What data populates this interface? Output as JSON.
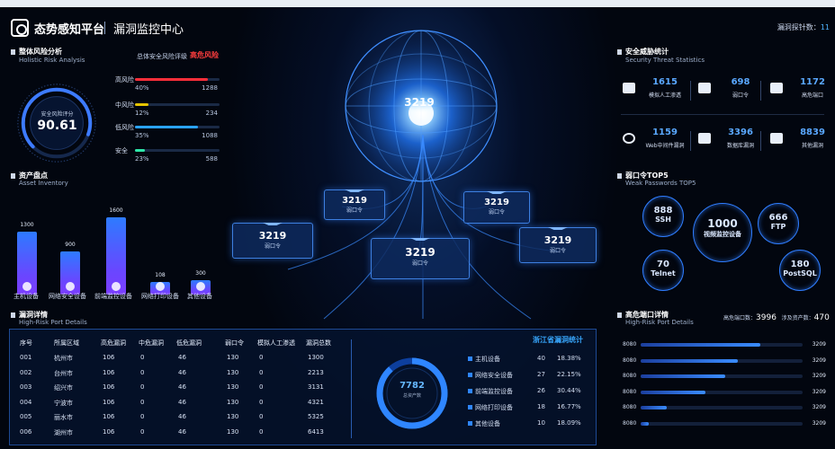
{
  "header": {
    "brand": "态势感知平台",
    "subtitle": "漏洞监控中心",
    "scan_label": "漏洞探针数：",
    "scan_value": "11"
  },
  "risk": {
    "title": "整体风险分析",
    "subtitle": "Holistic Risk Analysis",
    "score_label": "安全风险评分",
    "score": "90.61",
    "score_fraction": 0.9061,
    "overall_label": "总体安全风险评级",
    "overall_value": "高危风险",
    "levels": [
      {
        "name": "高风险",
        "percent": "40%",
        "count": "1288",
        "fill": 0.86,
        "color": "#ff2f3a"
      },
      {
        "name": "中风险",
        "percent": "12%",
        "count": "234",
        "fill": 0.16,
        "color": "#e6c400"
      },
      {
        "name": "低风险",
        "percent": "35%",
        "count": "1088",
        "fill": 0.74,
        "color": "#2aa3ff"
      },
      {
        "name": "安全",
        "percent": "23%",
        "count": "588",
        "fill": 0.12,
        "color": "#2ee6a8"
      }
    ]
  },
  "assets": {
    "title": "资产盘点",
    "subtitle": "Asset Inventory",
    "items": [
      {
        "name": "主机设备",
        "value": "1300",
        "num": 1300
      },
      {
        "name": "网络安全设备",
        "value": "900",
        "num": 900
      },
      {
        "name": "前端监控设备",
        "value": "1600",
        "num": 1600
      },
      {
        "name": "网络打印设备",
        "value": "108",
        "num": 108
      },
      {
        "name": "其他设备",
        "value": "300",
        "num": 300
      }
    ]
  },
  "center": {
    "cards": [
      {
        "value": "3219",
        "label": "弱口令"
      },
      {
        "value": "3219",
        "label": "弱口令"
      },
      {
        "value": "3219",
        "label": "弱口令"
      },
      {
        "value": "3219",
        "label": "弱口令"
      },
      {
        "value": "3219",
        "label": "弱口令"
      },
      {
        "value": "3219",
        "label": "弱口令"
      }
    ]
  },
  "threats": {
    "title": "安全威胁统计",
    "subtitle": "Security Threat Statistics",
    "items": [
      {
        "value": "1615",
        "label": "模拟人工渗透",
        "icon": "database-search-icon"
      },
      {
        "value": "698",
        "label": "弱口令",
        "icon": "password-dots-icon"
      },
      {
        "value": "1172",
        "label": "高危端口",
        "icon": "monitor-icon"
      },
      {
        "value": "1159",
        "label": "Web中间件漏洞",
        "icon": "web-icon"
      },
      {
        "value": "3396",
        "label": "数据库漏洞",
        "icon": "database-icon"
      },
      {
        "value": "8839",
        "label": "其他漏洞",
        "icon": "bar-chart-icon"
      }
    ]
  },
  "weak_pwd": {
    "title": "弱口令TOP5",
    "subtitle": "Weak Passwords TOP5",
    "items": [
      {
        "value": "888",
        "label": "SSH"
      },
      {
        "value": "1000",
        "label": "视频监控设备"
      },
      {
        "value": "666",
        "label": "FTP"
      },
      {
        "value": "70",
        "label": "Telnet"
      },
      {
        "value": "180",
        "label": "PostSQL"
      }
    ]
  },
  "high_ports": {
    "title": "高危端口详情",
    "subtitle": "High-Risk Port Details",
    "total_label": "高危端口数：",
    "total_value": "3996",
    "affected_label": "涉及资产数：",
    "affected_value": "470",
    "rows": [
      {
        "port": "8080",
        "value": "3209",
        "fill": 0.74
      },
      {
        "port": "8080",
        "value": "3209",
        "fill": 0.6
      },
      {
        "port": "8080",
        "value": "3209",
        "fill": 0.52
      },
      {
        "port": "8080",
        "value": "3209",
        "fill": 0.4
      },
      {
        "port": "8080",
        "value": "3209",
        "fill": 0.16
      },
      {
        "port": "8080",
        "value": "3209",
        "fill": 0.05
      }
    ]
  },
  "vuln": {
    "title": "漏洞详情",
    "subtitle": "High-Risk Port Details",
    "columns": [
      "序号",
      "所属区域",
      "高危漏洞",
      "中危漏洞",
      "低危漏洞",
      "弱口令",
      "模拟人工渗透",
      "漏洞总数"
    ],
    "rows": [
      [
        "001",
        "杭州市",
        "106",
        "0",
        "46",
        "130",
        "0",
        "1300"
      ],
      [
        "002",
        "台州市",
        "106",
        "0",
        "46",
        "130",
        "0",
        "2213"
      ],
      [
        "003",
        "绍兴市",
        "106",
        "0",
        "46",
        "130",
        "0",
        "3131"
      ],
      [
        "004",
        "宁波市",
        "106",
        "0",
        "46",
        "130",
        "0",
        "4321"
      ],
      [
        "005",
        "丽水市",
        "106",
        "0",
        "46",
        "130",
        "0",
        "5325"
      ],
      [
        "006",
        "湖州市",
        "106",
        "0",
        "46",
        "130",
        "0",
        "6413"
      ]
    ],
    "province_title": "浙江省漏洞统计",
    "total_value": "7782",
    "total_label": "总资产数",
    "legend": [
      {
        "name": "主机设备",
        "count": "40",
        "percent": "18.38%"
      },
      {
        "name": "网络安全设备",
        "count": "27",
        "percent": "22.15%"
      },
      {
        "name": "前端监控设备",
        "count": "26",
        "percent": "30.44%"
      },
      {
        "name": "网络打印设备",
        "count": "18",
        "percent": "16.77%"
      },
      {
        "name": "其他设备",
        "count": "10",
        "percent": "18.09%"
      }
    ]
  }
}
